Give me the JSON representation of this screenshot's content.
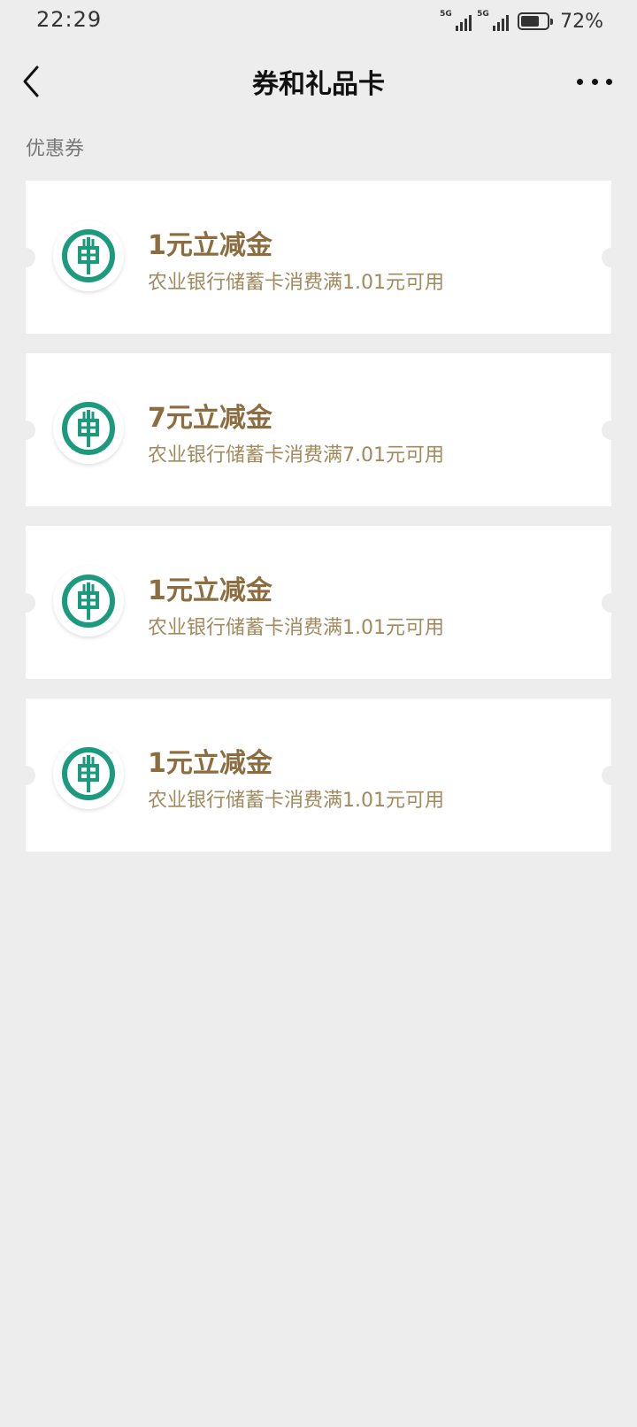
{
  "status_bar": {
    "time": "22:29",
    "network_1": "5G",
    "network_2": "5G",
    "battery_percent": "72%",
    "battery_level": 0.72
  },
  "nav": {
    "back_icon": "chevron-left-icon",
    "title": "券和礼品卡",
    "more_icon": "more-dots-icon"
  },
  "section": {
    "label": "优惠券"
  },
  "colors": {
    "background": "#ededed",
    "coupon_title": "#8c6d3f",
    "coupon_desc": "#a08a5e",
    "abc_green": "#1b9a7d"
  },
  "coupons": [
    {
      "title": "1元立减金",
      "desc": "农业银行储蓄卡消费满1.01元可用",
      "icon": "abc-bank-logo-icon"
    },
    {
      "title": "7元立减金",
      "desc": "农业银行储蓄卡消费满7.01元可用",
      "icon": "abc-bank-logo-icon"
    },
    {
      "title": "1元立减金",
      "desc": "农业银行储蓄卡消费满1.01元可用",
      "icon": "abc-bank-logo-icon"
    },
    {
      "title": "1元立减金",
      "desc": "农业银行储蓄卡消费满1.01元可用",
      "icon": "abc-bank-logo-icon"
    }
  ]
}
